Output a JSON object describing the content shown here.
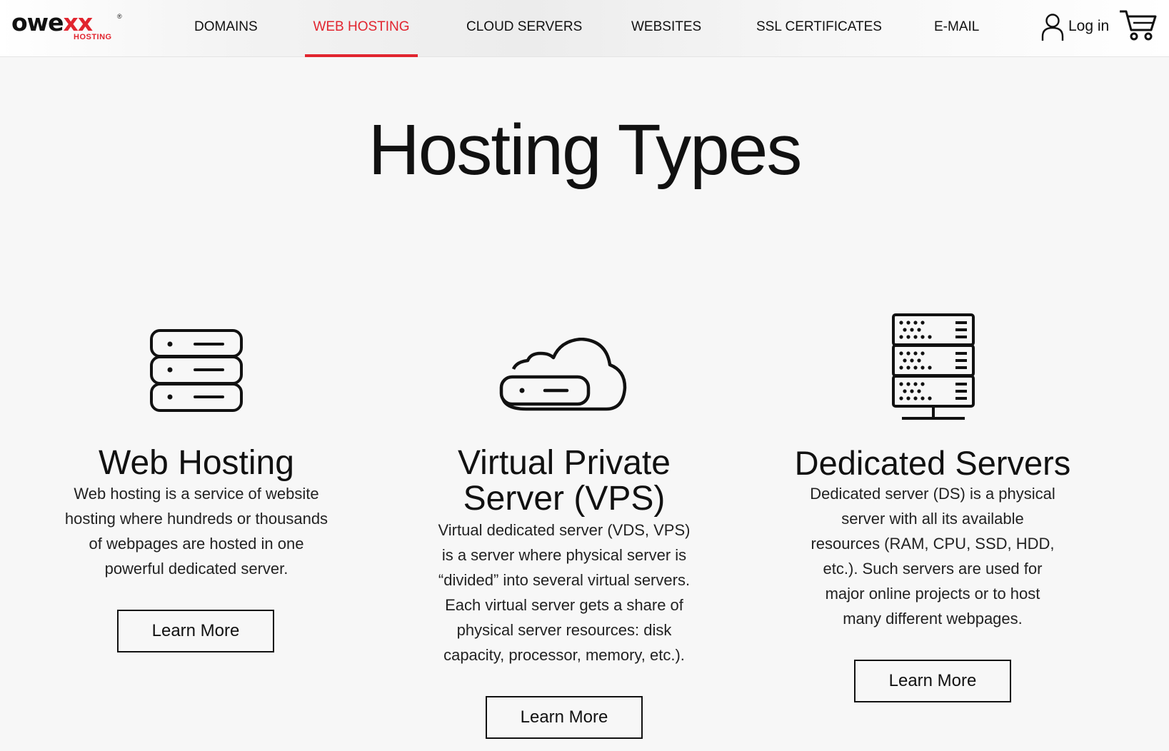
{
  "header": {
    "logo": {
      "word_a": "owe",
      "word_b": "xx",
      "reg": "®",
      "sub": "HOSTING"
    },
    "nav": [
      {
        "label": "DOMAINS"
      },
      {
        "label": "WEB HOSTING",
        "active": true
      },
      {
        "label": "CLOUD SERVERS"
      },
      {
        "label": "WEBSITES"
      },
      {
        "label": "SSL CERTIFICATES"
      },
      {
        "label": "E-MAIL"
      }
    ],
    "login_label": "Log in",
    "accent_color": "#e1252f"
  },
  "main": {
    "title": "Hosting Types",
    "cards": [
      {
        "icon": "server-stack-icon",
        "title": "Web Hosting",
        "description": "Web hosting is a service of website hosting where hundreds or thousands of webpages are hosted in one powerful dedicated server.",
        "button": "Learn More"
      },
      {
        "icon": "cloud-server-icon",
        "title": "Virtual Private Server (VPS)",
        "description": "Virtual dedicated server (VDS, VPS) is a server where physical server is “divided” into several virtual servers. Each virtual server gets a share of physical server resources: disk capacity, processor, memory, etc.).",
        "button": "Learn More"
      },
      {
        "icon": "server-rack-icon",
        "title": "Dedicated Servers",
        "description": "Dedicated server (DS) is a physical server with all its available resources (RAM, CPU, SSD, HDD, etc.). Such servers are used for major online projects or to host many different webpages.",
        "button": "Learn More"
      }
    ]
  }
}
